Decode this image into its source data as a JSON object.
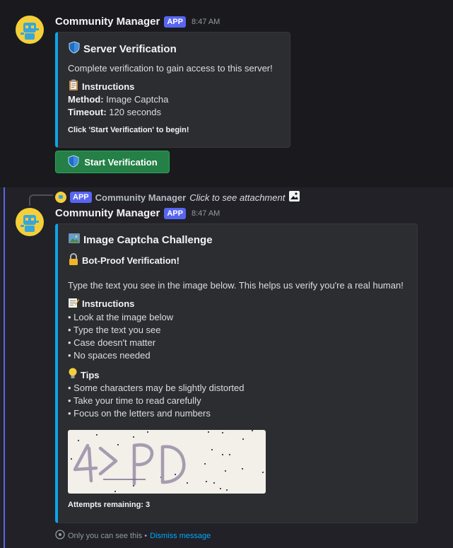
{
  "message1": {
    "author": "Community Manager",
    "app_tag": "APP",
    "time": "8:47 AM",
    "embed": {
      "title": "Server Verification",
      "description": "Complete verification to gain access to this server!",
      "instructions_title": "Instructions",
      "method_label": "Method:",
      "method_value": "Image Captcha",
      "timeout_label": "Timeout:",
      "timeout_value": "120 seconds",
      "footer_note": "Click 'Start Verification' to begin!"
    },
    "button_label": "Start Verification"
  },
  "reply": {
    "app_tag": "APP",
    "author": "Community Manager",
    "text": "Click to see attachment"
  },
  "message2": {
    "author": "Community Manager",
    "app_tag": "APP",
    "time": "8:47 AM",
    "embed": {
      "title": "Image Captcha Challenge",
      "subtitle": "Bot-Proof Verification!",
      "description": "Type the text you see in the image below. This helps us verify you're a real human!",
      "instructions_title": "Instructions",
      "instructions": [
        "• Look at the image below",
        "• Type the text you see",
        "• Case doesn't matter",
        "• No spaces needed"
      ],
      "tips_title": "Tips",
      "tips": [
        "• Some characters may be slightly distorted",
        "• Take your time to read carefully",
        "• Focus on the letters and numbers"
      ],
      "captcha_text": "4ZPD",
      "attempts": "Attempts remaining: 3"
    },
    "footer": {
      "only_you": "Only you can see this •",
      "dismiss": "Dismiss message"
    }
  },
  "colors": {
    "accent": "#5865f2",
    "embed_border": "#0ea5e9",
    "button_green": "#248046",
    "link": "#00a8fc"
  }
}
